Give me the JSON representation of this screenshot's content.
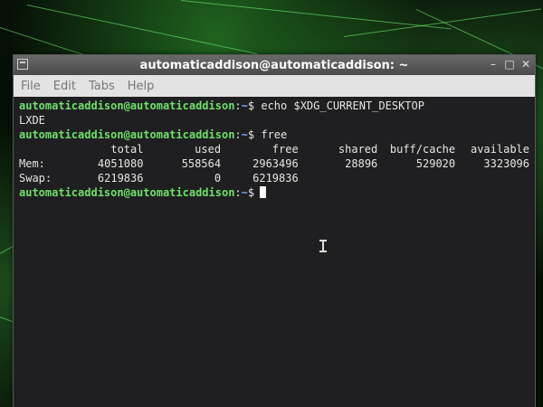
{
  "window": {
    "title": "automaticaddison@automaticaddison: ~",
    "controls": [
      "–",
      "□",
      "✕"
    ]
  },
  "menubar": {
    "items": [
      "File",
      "Edit",
      "Tabs",
      "Help"
    ]
  },
  "terminal": {
    "user_host": "automaticaddison@automaticaddison",
    "separator": ":",
    "cwd": "~",
    "prompt_symbol": "$",
    "commands": [
      {
        "cmd": "echo $XDG_CURRENT_DESKTOP",
        "output": "LXDE"
      },
      {
        "cmd": "free"
      }
    ],
    "free_output": {
      "headers": [
        "total",
        "used",
        "free",
        "shared",
        "buff/cache",
        "available"
      ],
      "rows": [
        {
          "label": "Mem:",
          "values": [
            "4051080",
            "558564",
            "2963496",
            "28896",
            "529020",
            "3323096"
          ]
        },
        {
          "label": "Swap:",
          "values": [
            "6219836",
            "0",
            "6219836",
            "",
            "",
            ""
          ]
        }
      ]
    }
  },
  "colors": {
    "prompt_user": "#6fe06a",
    "prompt_path": "#7aa6ff",
    "terminal_bg": "#1f1f21",
    "terminal_fg": "#e6e6e6"
  }
}
